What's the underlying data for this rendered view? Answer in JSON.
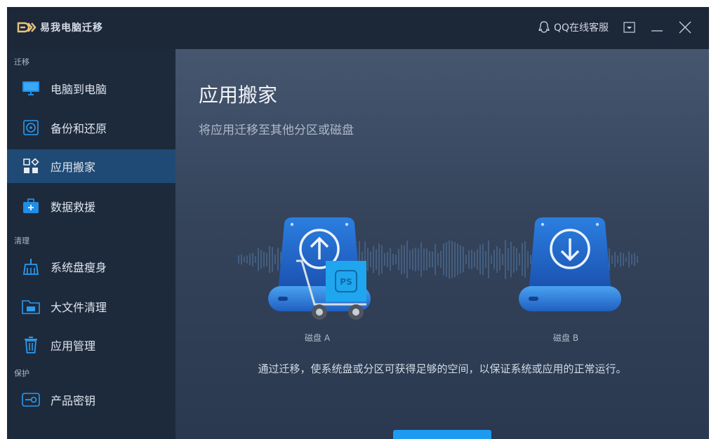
{
  "app": {
    "title": "易我电脑迁移",
    "accent": "#1d9bf0"
  },
  "titlebar": {
    "qq_label": "QQ在线客服"
  },
  "sidebar": {
    "sections": [
      {
        "label": "迁移"
      },
      {
        "label": "清理"
      },
      {
        "label": "保护"
      }
    ],
    "items": [
      {
        "label": "电脑到电脑",
        "icon": "monitor-icon"
      },
      {
        "label": "备份和还原",
        "icon": "backup-disc-icon"
      },
      {
        "label": "应用搬家",
        "icon": "apps-grid-icon",
        "active": true
      },
      {
        "label": "数据救援",
        "icon": "first-aid-kit-icon"
      },
      {
        "label": "系统盘瘦身",
        "icon": "broom-icon"
      },
      {
        "label": "大文件清理",
        "icon": "folder-gb-icon"
      },
      {
        "label": "应用管理",
        "icon": "trash-bin-icon"
      },
      {
        "label": "产品密钥",
        "icon": "product-key-icon"
      }
    ]
  },
  "main": {
    "title": "应用搬家",
    "subtitle": "将应用迁移至其他分区或磁盘",
    "disk_a_label": "磁盘 A",
    "disk_b_label": "磁盘 B",
    "description": "通过迁移，使系统盘或分区可获得足够的空间，以保证系统或应用的正常运行。",
    "cart_badge": "PS"
  }
}
